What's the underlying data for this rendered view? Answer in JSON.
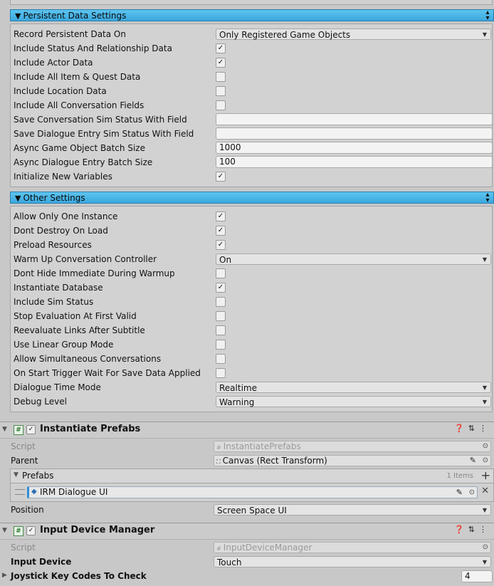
{
  "persistent": {
    "header": "Persistent Data Settings",
    "fields": [
      {
        "label": "Record Persistent Data On",
        "kind": "dropdown",
        "value": "Only Registered Game Objects"
      },
      {
        "label": "Include Status And Relationship Data",
        "kind": "check",
        "checked": true
      },
      {
        "label": "Include Actor Data",
        "kind": "check",
        "checked": true
      },
      {
        "label": "Include All Item & Quest Data",
        "kind": "check",
        "checked": false
      },
      {
        "label": "Include Location Data",
        "kind": "check",
        "checked": false
      },
      {
        "label": "Include All Conversation Fields",
        "kind": "check",
        "checked": false
      },
      {
        "label": "Save Conversation Sim Status With Field",
        "kind": "text",
        "value": ""
      },
      {
        "label": "Save Dialogue Entry Sim Status With Field",
        "kind": "text",
        "value": ""
      },
      {
        "label": "Async Game Object Batch Size",
        "kind": "text",
        "value": "1000"
      },
      {
        "label": "Async Dialogue Entry Batch Size",
        "kind": "text",
        "value": "100"
      },
      {
        "label": "Initialize New Variables",
        "kind": "check",
        "checked": true
      }
    ]
  },
  "other": {
    "header": "Other Settings",
    "fields": [
      {
        "label": "Allow Only One Instance",
        "kind": "check",
        "checked": true
      },
      {
        "label": "Dont Destroy On Load",
        "kind": "check",
        "checked": true
      },
      {
        "label": "Preload Resources",
        "kind": "check",
        "checked": true
      },
      {
        "label": "Warm Up Conversation Controller",
        "kind": "dropdown",
        "value": "On"
      },
      {
        "label": "Dont Hide Immediate During Warmup",
        "kind": "check",
        "checked": false
      },
      {
        "label": "Instantiate Database",
        "kind": "check",
        "checked": true
      },
      {
        "label": "Include Sim Status",
        "kind": "check",
        "checked": false
      },
      {
        "label": "Stop Evaluation At First Valid",
        "kind": "check",
        "checked": false
      },
      {
        "label": "Reevaluate Links After Subtitle",
        "kind": "check",
        "checked": false
      },
      {
        "label": "Use Linear Group Mode",
        "kind": "check",
        "checked": false
      },
      {
        "label": "Allow Simultaneous Conversations",
        "kind": "check",
        "checked": false
      },
      {
        "label": "On Start Trigger Wait For Save Data Applied",
        "kind": "check",
        "checked": false
      },
      {
        "label": "Dialogue Time Mode",
        "kind": "dropdown",
        "value": "Realtime"
      },
      {
        "label": "Debug Level",
        "kind": "dropdown",
        "value": "Warning"
      }
    ]
  },
  "instantiate_prefabs": {
    "title": "Instantiate Prefabs",
    "script_label": "Script",
    "script_value": "InstantiatePrefabs",
    "parent_label": "Parent",
    "parent_value": "Canvas (Rect Transform)",
    "prefabs_label": "Prefabs",
    "prefabs_count": "1 Items",
    "prefab_item": "IRM Dialogue UI",
    "position_label": "Position",
    "position_value": "Screen Space UI"
  },
  "input_device_manager": {
    "title": "Input Device Manager",
    "script_label": "Script",
    "script_value": "InputDeviceManager",
    "input_device_label": "Input Device",
    "input_device_value": "Touch",
    "joystick_label": "Joystick Key Codes To Check",
    "joystick_value": "4"
  },
  "icons": {
    "help": "help-icon",
    "settings": "settings-icon",
    "menu": "kebab-menu-icon",
    "checkmark": "✓"
  }
}
